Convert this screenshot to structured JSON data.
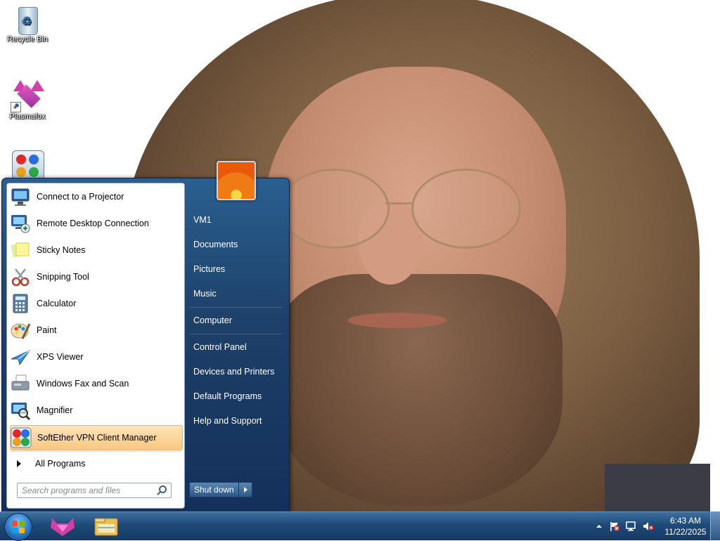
{
  "desktop": {
    "icons": [
      {
        "label": "Recycle Bin",
        "icon": "recycle-bin-icon"
      },
      {
        "label": "Plasmafox",
        "icon": "plasmafox-icon"
      },
      {
        "label": "",
        "icon": "softether-vpn-icon"
      }
    ]
  },
  "start_menu": {
    "programs": [
      {
        "label": "Connect to a Projector",
        "icon": "projector-icon"
      },
      {
        "label": "Remote Desktop Connection",
        "icon": "remote-desktop-icon"
      },
      {
        "label": "Sticky Notes",
        "icon": "sticky-notes-icon"
      },
      {
        "label": "Snipping Tool",
        "icon": "snipping-tool-icon"
      },
      {
        "label": "Calculator",
        "icon": "calculator-icon"
      },
      {
        "label": "Paint",
        "icon": "paint-icon"
      },
      {
        "label": "XPS Viewer",
        "icon": "xps-viewer-icon"
      },
      {
        "label": "Windows Fax and Scan",
        "icon": "fax-scan-icon"
      },
      {
        "label": "Magnifier",
        "icon": "magnifier-icon"
      },
      {
        "label": "SoftEther VPN Client Manager",
        "icon": "softether-vpn-icon"
      }
    ],
    "highlighted_program": "SoftEther VPN Client Manager",
    "all_programs": "All Programs",
    "search_placeholder": "Search programs and files",
    "right_links": [
      {
        "label": "VM1"
      },
      {
        "label": "Documents"
      },
      {
        "label": "Pictures"
      },
      {
        "label": "Music"
      },
      {
        "label": "Computer"
      },
      {
        "label": "Control Panel"
      },
      {
        "label": "Devices and Printers"
      },
      {
        "label": "Default Programs"
      },
      {
        "label": "Help and Support"
      }
    ],
    "shutdown_label": "Shut down"
  },
  "taskbar": {
    "pinned": [
      "plasmafox-icon",
      "windows-explorer-icon"
    ],
    "tray_icons": [
      "show-hidden-icons-arrow",
      "action-center-flag-icon",
      "network-icon",
      "volume-muted-icon"
    ],
    "clock_time": "6:43 AM",
    "clock_date": "11/22/2025"
  },
  "colors": {
    "start_menu_blue": "#1d3f68",
    "highlight": "#f9c883",
    "taskbar": "#1f4a78"
  }
}
